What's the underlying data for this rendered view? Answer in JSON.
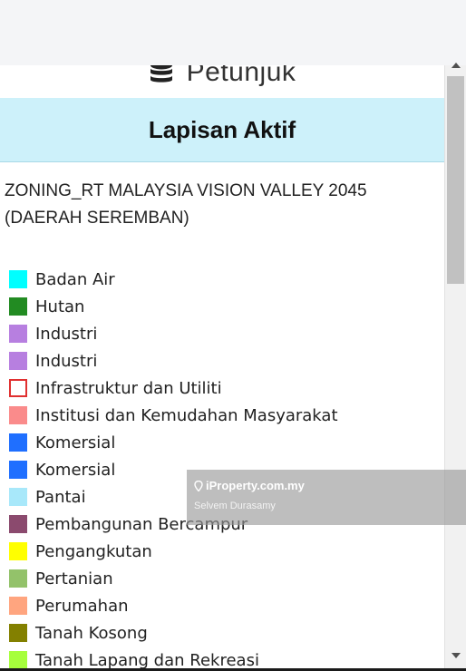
{
  "panel": {
    "title": "Petunjuk",
    "icon": "database-icon"
  },
  "section": {
    "title": "Lapisan Aktif"
  },
  "layer": {
    "name": "ZONING_RT MALAYSIA VISION VALLEY 2045 (DAERAH SEREMBAN)"
  },
  "legend": [
    {
      "label": "Badan Air",
      "color": "#00ffff"
    },
    {
      "label": "Hutan",
      "color": "#228b22"
    },
    {
      "label": "Industri",
      "color": "#b77fe0"
    },
    {
      "label": "Industri",
      "color": "#b77fe0"
    },
    {
      "label": "Infrastruktur dan Utiliti",
      "color": "#e03030",
      "style": "outline"
    },
    {
      "label": "Institusi dan Kemudahan Masyarakat",
      "color": "#fa8b8b"
    },
    {
      "label": "Komersial",
      "color": "#1f6fff"
    },
    {
      "label": "Komersial",
      "color": "#1f6fff"
    },
    {
      "label": "Pantai",
      "color": "#a8e8fa"
    },
    {
      "label": "Pembangunan Bercampur",
      "color": "#8b4a6e"
    },
    {
      "label": "Pengangkutan",
      "color": "#ffff00"
    },
    {
      "label": "Pertanian",
      "color": "#93c26a"
    },
    {
      "label": "Perumahan",
      "color": "#ffa57f"
    },
    {
      "label": "Tanah Kosong",
      "color": "#838000"
    },
    {
      "label": "Tanah Lapang dan Rekreasi",
      "color": "#a6ff3c"
    }
  ],
  "watermark": {
    "brand": "iProperty.com.my",
    "author": "Selvem Durasamy"
  }
}
